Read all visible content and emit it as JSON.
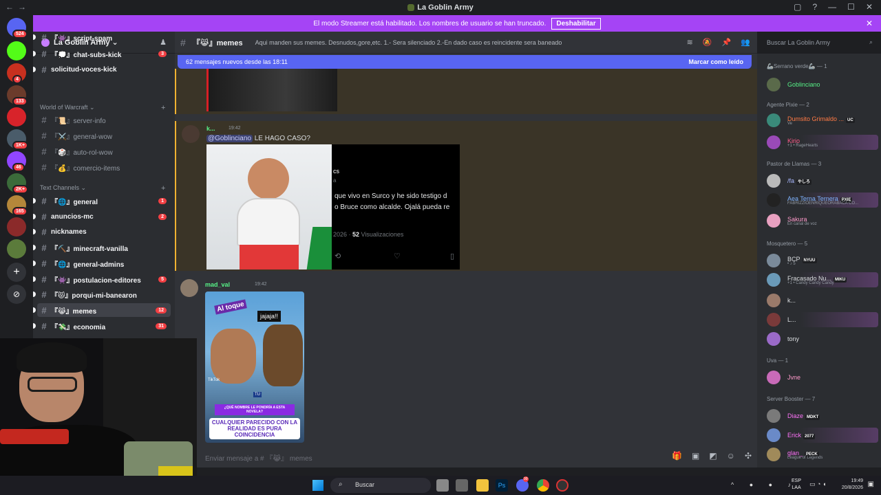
{
  "window": {
    "title": "La Goblin Army",
    "nav_back": "←",
    "nav_fwd": "→",
    "inbox_icon": "▢",
    "help_icon": "?",
    "min": "—",
    "max": "☐",
    "close": "✕"
  },
  "notice": {
    "text": "El modo Streamer está habilitado. Los nombres de usuario se han truncado.",
    "button": "Deshabilitar",
    "close": "✕"
  },
  "servers": [
    {
      "badge": "524",
      "color": "#5865f2"
    },
    {
      "badge": "",
      "color": "#53fc18"
    },
    {
      "badge": "4",
      "color": "#c8301f"
    },
    {
      "badge": "133",
      "color": "#6b3b2b"
    },
    {
      "badge": "",
      "color": "#d8232a"
    },
    {
      "badge": "1K+",
      "color": "#4a5c6a"
    },
    {
      "badge": "46",
      "color": "#9146ff"
    },
    {
      "badge": "2K+",
      "color": "#3b6b3a"
    },
    {
      "badge": "165",
      "color": "#b5873a"
    },
    {
      "badge": "",
      "color": "#8b2a2a"
    },
    {
      "badge": "",
      "color": "#5b7b3b"
    }
  ],
  "server": {
    "name": "La Goblin Army",
    "chevron": "⌄",
    "add_user_icon": "♟"
  },
  "sidebar": {
    "channels_top": [
      {
        "label": "『👾』script-spam",
        "count": ""
      },
      {
        "label": "『💭』chat-subs-kick",
        "count": "3"
      },
      {
        "label": "solicitud-voces-kick",
        "count": ""
      }
    ],
    "cat_wow": "World of Warcraft",
    "wow": [
      {
        "label": "『📜』server-info"
      },
      {
        "label": "『⚔️』general-wow"
      },
      {
        "label": "『🎲』auto-rol-wow"
      },
      {
        "label": "『💰』comercio-items"
      }
    ],
    "cat_text": "Text Channels",
    "text": [
      {
        "label": "『🌐』general",
        "count": "1"
      },
      {
        "label": "anuncios-mc",
        "count": "2"
      },
      {
        "label": "nicknames",
        "count": ""
      },
      {
        "label": "『⛏️』minecraft-vanilla",
        "count": ""
      },
      {
        "label": "『🌐』general-admins",
        "count": ""
      },
      {
        "label": "『👾』postulacion-editores",
        "count": "5"
      },
      {
        "label": "『😾』porqui-mi-banearon",
        "count": ""
      },
      {
        "label": "『😹』memes",
        "count": "12"
      },
      {
        "label": "『💸』economia",
        "count": "31"
      }
    ]
  },
  "channel": {
    "name": "『😹』memes",
    "topic": "Aqui manden sus memes. Desnudos,gore,etc. 1.- Sera silenciado 2.-En dado caso es reincidente sera baneado",
    "search_placeholder": "Buscar La Goblin Army"
  },
  "new_messages": {
    "text": "62 mensajes nuevos desde las 18:11",
    "mark": "Marcar como leído"
  },
  "messages": [
    {
      "author": "k...",
      "time": "19:42",
      "mention": "@Goblinciano",
      "text": " LE HAGO CASO?",
      "embed_lines": [
        "cs",
        "a",
        "que vivo en Surco y he sido testigo d",
        "o Bruce como alcalde. Ojalá pueda re"
      ],
      "embed_stats_pre": "2026 · ",
      "embed_stats_bold": "52",
      "embed_stats_post": " Visualizaciones"
    },
    {
      "author": "mad_val",
      "time": "19:42",
      "video_texts": [
        "Al toque",
        "jajaja!!",
        "TikTok",
        "TU",
        "¿QUÉ NOMBRE LE PONDRÍA A ESTA NOVELA?",
        "CUALQUIER PARECIDO CON LA REALIDAD ES PURA COINCIDENCIA"
      ]
    }
  ],
  "composer": {
    "placeholder": "Enviar mensaje a # 『😹』 memes"
  },
  "members": {
    "groups": [
      {
        "title": "🦾Serrano verde🦾 — 1",
        "items": [
          {
            "name": "Goblinciano",
            "color": "#57f287",
            "sub": "",
            "tag": ""
          }
        ]
      },
      {
        "title": "Agente Pixie — 2",
        "items": [
          {
            "name": "Dumsito Grimaldo ...",
            "color": "#ff7a45",
            "sub": "Ve",
            "tag": "UC"
          },
          {
            "name": "Kirio",
            "color": "#ff5c8a",
            "sub": "+1 • RageHearts",
            "tag": ""
          }
        ]
      },
      {
        "title": "Pastor de Llamas — 3",
        "items": [
          {
            "name": "/fa",
            "color": "#a9b7ff",
            "sub": "",
            "tag": "やしろ"
          },
          {
            "name": "Aea Terna Ternera",
            "color": "#7fb3ff",
            "sub": "FABRIZZIOENRIQUEORABACA CO...",
            "tag": "PXIE"
          },
          {
            "name": "Sakura",
            "color": "#ff9acb",
            "sub": "En canal de voz",
            "tag": ""
          }
        ]
      },
      {
        "title": "Mosquetero — 5",
        "items": [
          {
            "name": "BCP",
            "color": "#dbdee1",
            "sub": "• ♪ 5",
            "tag": "NYUU"
          },
          {
            "name": "Fracasado Nu...",
            "color": "#dbdee1",
            "sub": "+1 • Candy Candy Candy",
            "tag": "MIKU"
          },
          {
            "name": "k...",
            "color": "#dbdee1",
            "sub": "",
            "tag": ""
          },
          {
            "name": "L...",
            "color": "#dbdee1",
            "sub": "",
            "tag": ""
          },
          {
            "name": "tony",
            "color": "#dbdee1",
            "sub": "",
            "tag": ""
          }
        ]
      },
      {
        "title": "Uva — 1",
        "items": [
          {
            "name": "Jvne",
            "color": "#ff9acb",
            "sub": "",
            "tag": ""
          }
        ]
      },
      {
        "title": "Server Booster — 7",
        "items": [
          {
            "name": "Diaze",
            "color": "#ff73fa",
            "sub": "",
            "tag": "MDKT"
          },
          {
            "name": "Erick",
            "color": "#ff73fa",
            "sub": "",
            "tag": "2077"
          },
          {
            "name": "glan_",
            "color": "#ff73fa",
            "sub": "League of Legends",
            "tag": "PECK"
          }
        ]
      }
    ]
  },
  "taskbar": {
    "search": "Buscar",
    "lang1": "ESP",
    "lang2": "LAA",
    "time": "19:49",
    "date": "20/8/2026",
    "ps": "Ps",
    "discord_badge": "99"
  }
}
